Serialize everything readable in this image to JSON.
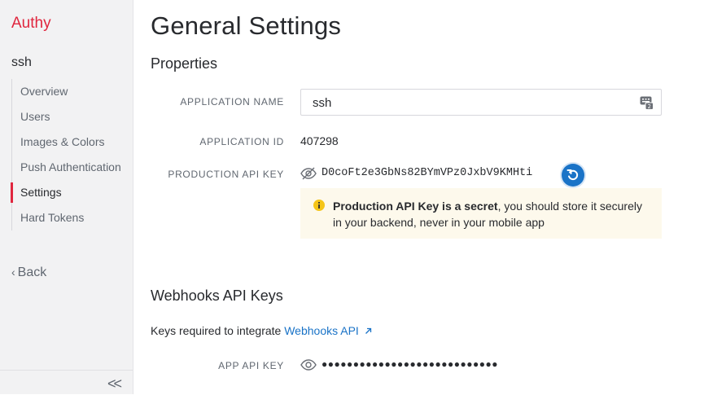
{
  "sidebar": {
    "brand": "Authy",
    "app_name": "ssh",
    "items": [
      {
        "label": "Overview"
      },
      {
        "label": "Users"
      },
      {
        "label": "Images & Colors"
      },
      {
        "label": "Push Authentication"
      },
      {
        "label": "Settings",
        "active": true
      },
      {
        "label": "Hard Tokens"
      }
    ],
    "back_label": "Back",
    "collapse_glyph": "<<"
  },
  "main": {
    "title": "General Settings",
    "properties": {
      "heading": "Properties",
      "app_name_label": "APPLICATION NAME",
      "app_name_value": "ssh",
      "app_id_label": "APPLICATION ID",
      "app_id_value": "407298",
      "prod_key_label": "PRODUCTION API KEY",
      "prod_key_value": "D0coFt2e3GbNs82BYmVPz0JxbV9KMHti",
      "notice_bold": "Production API Key is a secret",
      "notice_rest": ", you should store it securely in your backend, never in your mobile app"
    },
    "webhooks": {
      "heading": "Webhooks API Keys",
      "desc_prefix": "Keys required to integrate ",
      "desc_link": "Webhooks API",
      "app_key_label": "APP API KEY",
      "app_key_masked": "●●●●●●●●●●●●●●●●●●●●●●●●●●●●"
    }
  },
  "colors": {
    "brand": "#e0263e",
    "link": "#1a73c7",
    "notice_bg": "#fdf9ec",
    "warning": "#f5c518"
  },
  "icons": [
    "keyboard-icon",
    "eye-slash-icon",
    "refresh-icon",
    "info-icon",
    "external-link-icon",
    "eye-icon",
    "chevron-left-icon",
    "double-chevron-left-icon"
  ]
}
